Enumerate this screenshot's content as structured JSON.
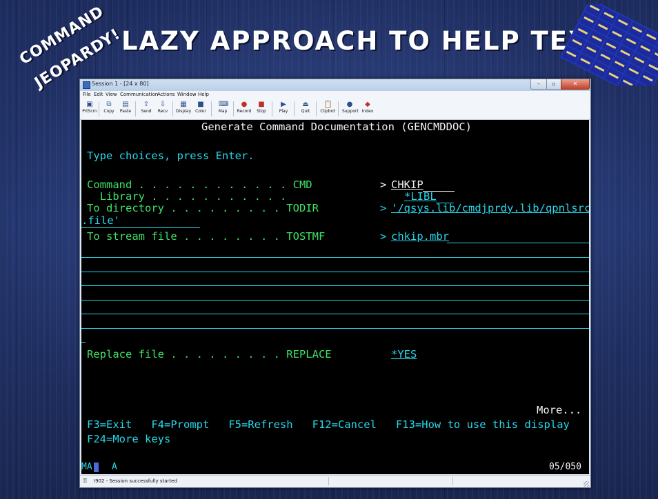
{
  "slide": {
    "logo_left": [
      "COMMAND",
      "JEOPARDY!"
    ],
    "title": "LAZY APPROACH TO HELP TEXT"
  },
  "window": {
    "title": "Session 1 - [24 x 80]",
    "controls": [
      "–",
      "▫",
      "✕"
    ],
    "menu": [
      "File",
      "Edit",
      "View",
      "Communication",
      "Actions",
      "Window",
      "Help"
    ],
    "toolbar": [
      "PrtScrn",
      "Copy",
      "Paste",
      "Send",
      "Recv",
      "Display",
      "Color",
      "Map",
      "Record",
      "Stop",
      "Play",
      "Quit",
      "Clipbrd",
      "Support",
      "Index"
    ]
  },
  "terminal": {
    "heading": "Generate Command Documentation (GENCMDDOC)",
    "instruction": "Type choices, press Enter.",
    "fields": [
      {
        "label": "Command . . . . . . . . . . . . CMD",
        "marker": ">",
        "value": "CHKIP"
      },
      {
        "label": "  Library . . . . . . . . . . .",
        "marker": "",
        "value": "*LIBL"
      },
      {
        "label": "To directory . . . . . . . . . TODIR",
        "marker": ">",
        "value": "'/qsys.lib/cmdjprdy.lib/qpnlsrc",
        "continuation": ".file'"
      },
      {
        "label": "To stream file . . . . . . . . TOSTMF",
        "marker": ">",
        "value": "chkip.mbr"
      },
      {
        "label": "Replace file . . . . . . . . . REPLACE",
        "marker": "",
        "value": "*YES"
      }
    ],
    "more": "More...",
    "fkeys_line1": "F3=Exit   F4=Prompt   F5=Refresh   F12=Cancel   F13=How to use this display",
    "fkeys_line2": "F24=More keys",
    "oia_left": "MA",
    "oia_mode": "A",
    "oia_position": "05/050"
  },
  "status": {
    "message": "I902 - Session successfully started"
  }
}
